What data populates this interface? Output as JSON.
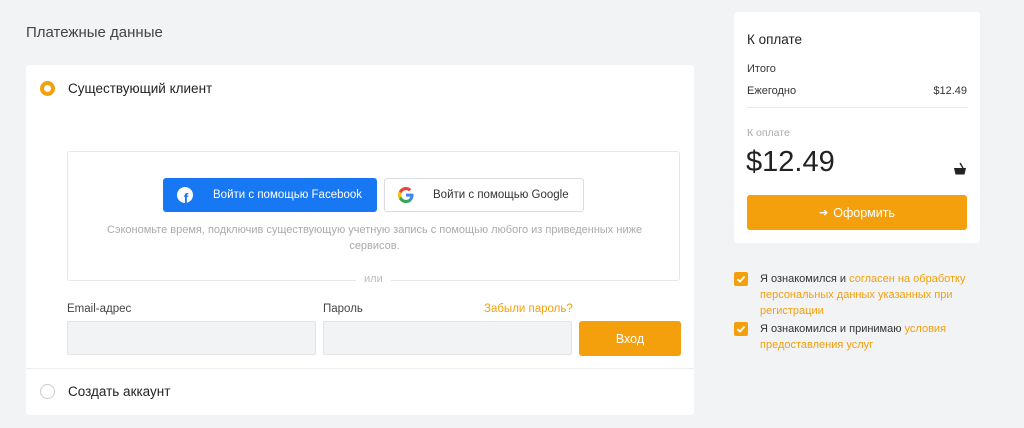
{
  "page": {
    "title": "Платежные данные"
  },
  "auth": {
    "existing_client_label": "Существующий клиент",
    "facebook_label": "Войти с помощью Facebook",
    "google_label": "Войти с помощью Google",
    "social_hint": "Сэкономьте время, подключив существующую учетную запись с помощью любого из приведенных ниже сервисов.",
    "or_label": "или",
    "email_label": "Email-адрес",
    "email_value": "",
    "password_label": "Пароль",
    "password_value": "",
    "forgot_label": "Забыли пароль?",
    "login_label": "Вход",
    "create_account_label": "Создать аккаунт"
  },
  "summary": {
    "title": "К оплате",
    "total_label": "Итого",
    "yearly_label": "Ежегодно",
    "yearly_price": "$12.49",
    "due_label": "К оплате",
    "due_amount": "$12.49",
    "checkout_label": "Оформить"
  },
  "consents": [
    {
      "prefix": "Я ознакомился и ",
      "link": "согласен на обработку персональных данных указанных при регистрации"
    },
    {
      "prefix": "Я ознакомился и принимаю ",
      "link": "условия предоставления услуг"
    }
  ],
  "colors": {
    "accent": "#f4a00c",
    "facebook": "#1877f2"
  },
  "icons": {
    "facebook": "facebook-icon",
    "google": "google-icon",
    "basket": "basket-icon",
    "arrow": "arrow-right-icon",
    "check": "checkmark-icon"
  }
}
